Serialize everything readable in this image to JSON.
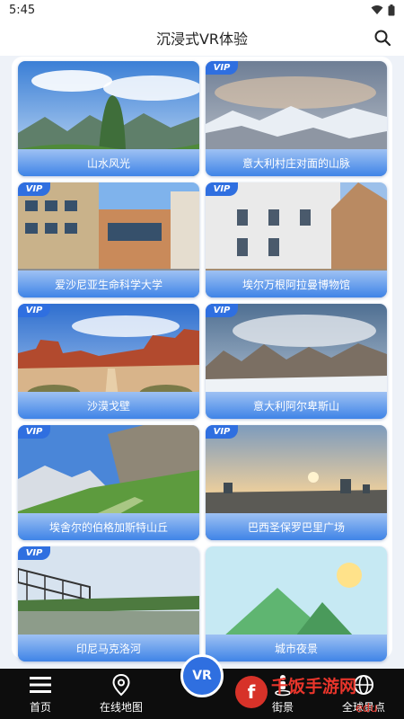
{
  "status_bar": {
    "time": "5:45"
  },
  "header": {
    "title": "沉浸式VR体验"
  },
  "cards": [
    {
      "label": "山水风光",
      "vip": false
    },
    {
      "label": "意大利村庄对面的山脉",
      "vip": true,
      "vip_text": "VIP"
    },
    {
      "label": "爱沙尼亚生命科学大学",
      "vip": true,
      "vip_text": "VIP"
    },
    {
      "label": "埃尔万根阿拉曼博物馆",
      "vip": true,
      "vip_text": "VIP"
    },
    {
      "label": "沙漠戈壁",
      "vip": true,
      "vip_text": "VIP"
    },
    {
      "label": "意大利阿尔卑斯山",
      "vip": true,
      "vip_text": "VIP"
    },
    {
      "label": "埃舍尔的伯格加斯特山丘",
      "vip": true,
      "vip_text": "VIP"
    },
    {
      "label": "巴西圣保罗巴里广场",
      "vip": true,
      "vip_text": "VIP"
    },
    {
      "label": "印尼马克洛河",
      "vip": true,
      "vip_text": "VIP"
    },
    {
      "label": "城市夜景",
      "vip": false
    }
  ],
  "nav": {
    "home": "首页",
    "map": "在线地图",
    "vr": "VR",
    "street": "街景",
    "global": "全球景点"
  },
  "watermark": {
    "brand": "千饭手游网",
    "url": "edu"
  },
  "colors": {
    "accent": "#2f6fe0",
    "nav_bg": "#0d0d0d"
  }
}
